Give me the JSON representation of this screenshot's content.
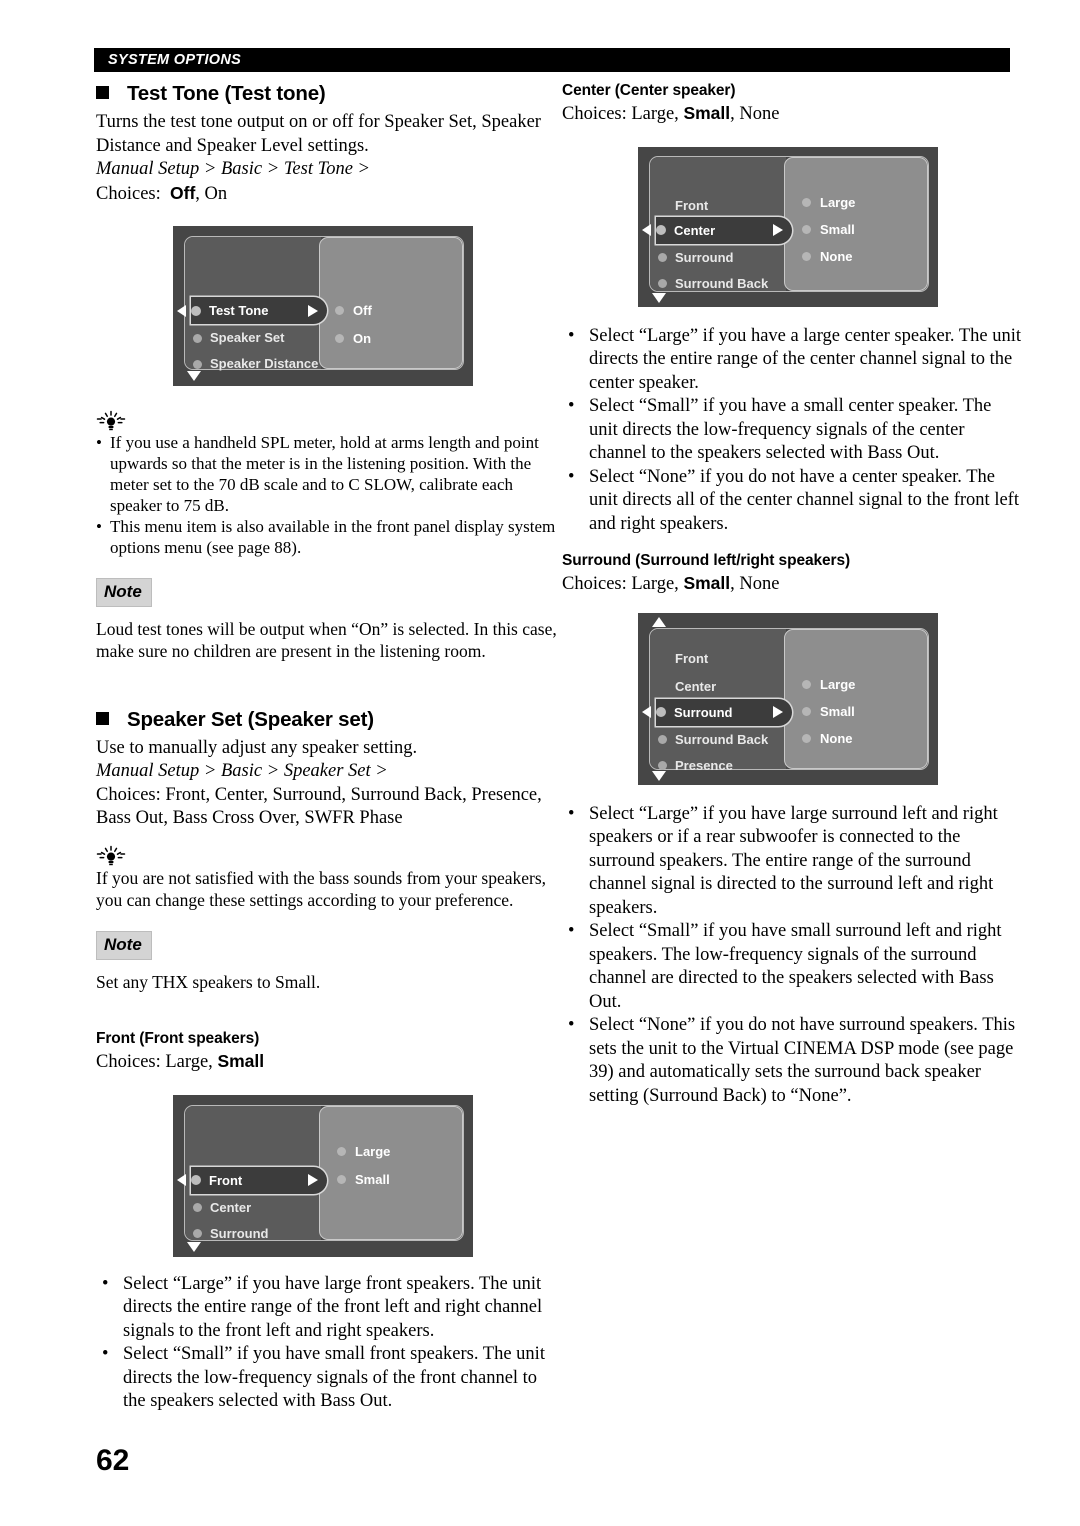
{
  "header": {
    "running_head": "SYSTEM OPTIONS"
  },
  "page_number": "62",
  "left_column": {
    "test_tone": {
      "heading": "Test Tone (Test tone)",
      "description": "Turns the test tone output on or off for Speaker Set, Speaker Distance and Speaker Level settings.",
      "path": "Manual Setup > Basic > Test Tone >",
      "choices_label": "Choices:",
      "choices_default": "Off",
      "choices_rest": ", On",
      "osd": {
        "menu_items": [
          "Test Tone",
          "Speaker Set",
          "Speaker Distance"
        ],
        "selected_item": "Test Tone",
        "options": [
          "Off",
          "On"
        ],
        "scroll_down": true,
        "scroll_up": false
      },
      "tips": [
        "If you use a handheld SPL meter, hold at arms length and point upwards so that the meter is in the listening position. With the meter set to the 70 dB scale and to C SLOW, calibrate each speaker to 75 dB.",
        "This menu item is also available in the front panel display system options menu (see page 88)."
      ],
      "note_label": "Note",
      "note_text": "Loud test tones will be output when “On” is selected. In this case, make sure no children are present in the listening room."
    },
    "speaker_set": {
      "heading": "Speaker Set (Speaker set)",
      "description": "Use to manually adjust any speaker setting.",
      "path": "Manual Setup > Basic > Speaker Set >",
      "choices": "Choices: Front, Center, Surround, Surround Back, Presence, Bass Out, Bass Cross Over, SWFR Phase",
      "tip": "If you are not satisfied with the bass sounds from your speakers, you can change these settings according to your preference.",
      "note_label": "Note",
      "note_text": "Set any THX speakers to Small."
    },
    "front": {
      "heading": "Front (Front speakers)",
      "choices_label": "Choices:",
      "choices_pre": " Large, ",
      "choices_default": "Small",
      "osd": {
        "menu_items": [
          "Front",
          "Center",
          "Surround"
        ],
        "selected_item": "Front",
        "options": [
          "Large",
          "Small"
        ],
        "scroll_down": true,
        "scroll_up": false
      },
      "bullets": [
        "Select “Large” if you have large front speakers. The unit directs the entire range of the front left and right channel signals to the front left and right speakers.",
        "Select “Small” if you have small front speakers. The unit directs the low-frequency signals of the front channel to the speakers selected with Bass Out."
      ]
    }
  },
  "right_column": {
    "center": {
      "heading": "Center (Center speaker)",
      "choices_label": "Choices:",
      "choices_pre": " Large, ",
      "choices_default": "Small",
      "choices_post": ", None",
      "osd": {
        "menu_items": [
          "Front",
          "Center",
          "Surround",
          "Surround Back"
        ],
        "selected_item": "Center",
        "options": [
          "Large",
          "Small",
          "None"
        ],
        "scroll_down": true,
        "scroll_up": false
      },
      "bullets": [
        "Select “Large” if you have a large center speaker. The unit directs the entire range of the center channel signal to the center speaker.",
        "Select “Small” if you have a small center speaker. The unit directs the low-frequency signals of the center channel to the speakers selected with Bass Out.",
        "Select “None” if you do not have a center speaker. The unit directs all of the center channel signal to the front left and right speakers."
      ]
    },
    "surround": {
      "heading": "Surround (Surround left/right speakers)",
      "choices_label": "Choices:",
      "choices_pre": " Large, ",
      "choices_default": "Small",
      "choices_post": ", None",
      "osd": {
        "menu_items": [
          "Front",
          "Center",
          "Surround",
          "Surround Back",
          "Presence"
        ],
        "selected_item": "Surround",
        "options": [
          "Large",
          "Small",
          "None"
        ],
        "scroll_down": true,
        "scroll_up": true
      },
      "bullets": [
        "Select “Large” if you have large surround left and right speakers or if a rear subwoofer is connected to the surround speakers. The entire range of the surround channel signal is directed to the surround left and right speakers.",
        "Select “Small” if you have small surround left and right speakers. The low-frequency signals of the surround channel are directed to the speakers selected with Bass Out.",
        "Select “None” if you do not have surround speakers. This sets the unit to the Virtual CINEMA DSP mode (see page 39) and automatically sets the surround back speaker setting (Surround Back) to “None”."
      ]
    }
  },
  "colors": {
    "osd_frame": "#464646",
    "osd_left_pane": "#5b5b5b",
    "osd_right_pane": "#8e8e8e",
    "osd_highlight": "#3c3c3c",
    "note_badge": "#d4d4d4",
    "header_bar": "#000000"
  }
}
